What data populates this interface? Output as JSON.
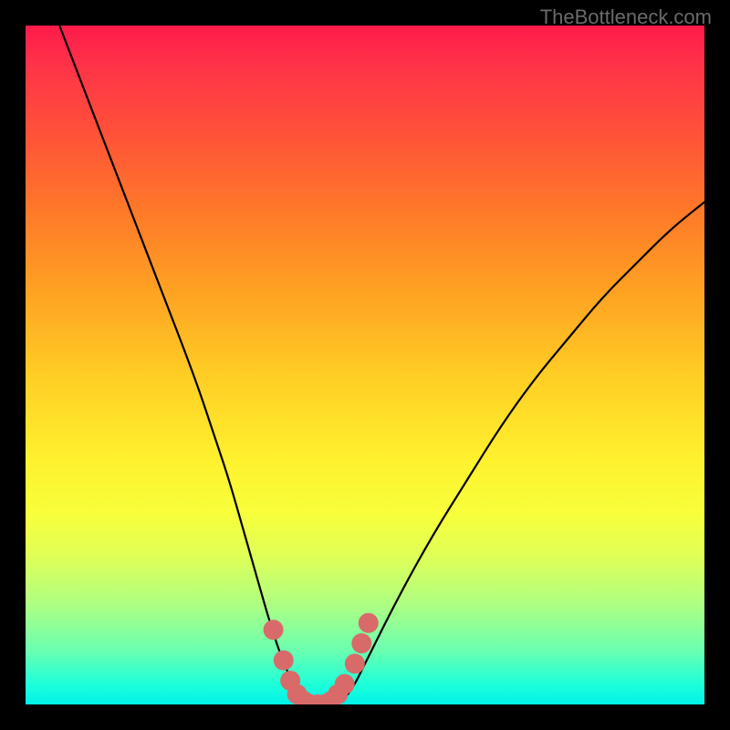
{
  "watermark": "TheBottleneck.com",
  "chart_data": {
    "type": "line",
    "title": "",
    "xlabel": "",
    "ylabel": "",
    "xlim": [
      0,
      100
    ],
    "ylim": [
      0,
      100
    ],
    "series": [
      {
        "name": "bottleneck-curve",
        "x": [
          5,
          10,
          15,
          20,
          25,
          28,
          30,
          32,
          34,
          36,
          38,
          40,
          42,
          44,
          46,
          48,
          50,
          55,
          60,
          65,
          70,
          75,
          80,
          85,
          90,
          95,
          100
        ],
        "y": [
          100,
          87,
          74,
          61,
          48,
          39,
          33,
          26,
          19,
          12,
          6,
          2,
          0,
          0,
          0,
          2,
          6,
          16,
          25,
          33,
          41,
          48,
          54,
          60,
          65,
          70,
          74
        ]
      }
    ],
    "markers": {
      "name": "highlight-dots",
      "x": [
        36.5,
        38,
        39,
        40,
        41,
        42,
        43,
        44,
        45,
        46,
        47,
        48.5,
        49.5,
        50.5
      ],
      "y": [
        11,
        6.5,
        3.5,
        1.5,
        0.5,
        0,
        0,
        0,
        0.5,
        1.5,
        3,
        6,
        9,
        12
      ]
    },
    "gradient_stops": [
      {
        "pos": 0.0,
        "color": "#ff1b4a"
      },
      {
        "pos": 0.16,
        "color": "#ff5238"
      },
      {
        "pos": 0.4,
        "color": "#ffa522"
      },
      {
        "pos": 0.64,
        "color": "#fff12e"
      },
      {
        "pos": 0.85,
        "color": "#b0ff80"
      },
      {
        "pos": 1.0,
        "color": "#00f2e8"
      }
    ]
  }
}
